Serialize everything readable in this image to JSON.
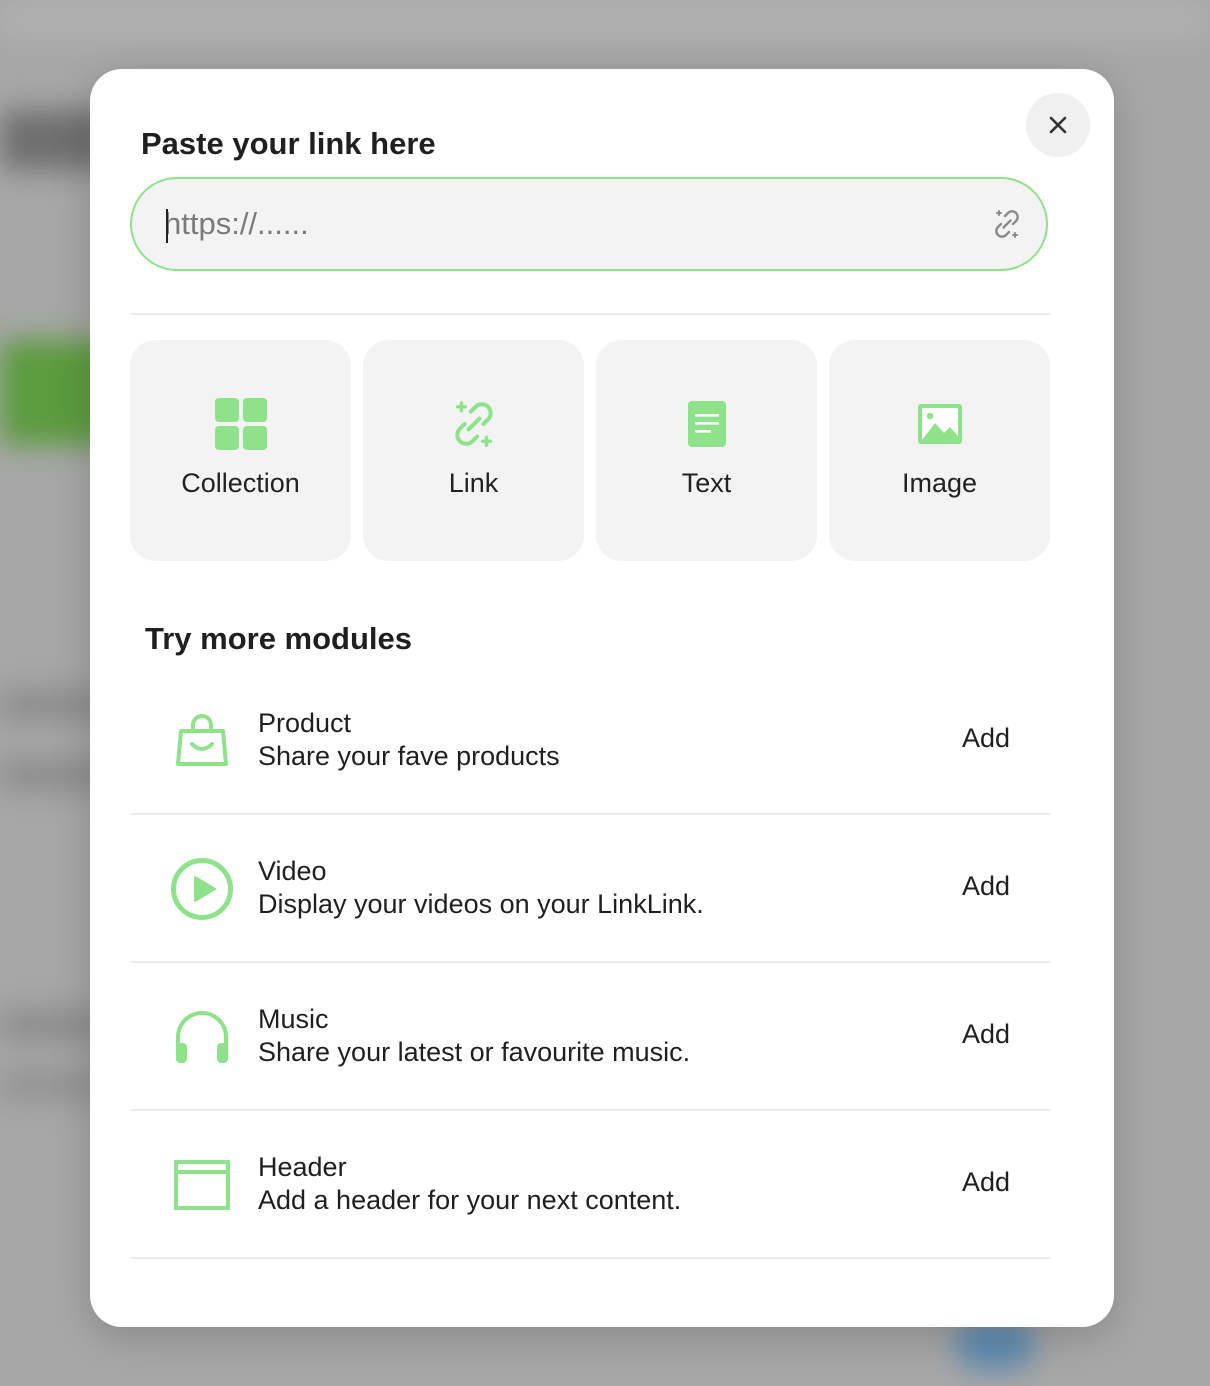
{
  "theme": {
    "accent": "#8ee28a",
    "tile_background": "#f3f3f3",
    "close_button_background": "#f0f0f0"
  },
  "modal": {
    "title": "Paste your link here",
    "close_icon": "close-icon",
    "url_input": {
      "value": "",
      "placeholder": "https://......",
      "icon": "link-icon"
    }
  },
  "tiles": [
    {
      "label": "Collection",
      "icon": "grid-icon"
    },
    {
      "label": "Link",
      "icon": "link-icon"
    },
    {
      "label": "Text",
      "icon": "document-icon"
    },
    {
      "label": "Image",
      "icon": "image-icon"
    }
  ],
  "more_modules": {
    "title": "Try more modules",
    "items": [
      {
        "name": "Product",
        "description": "Share your fave products",
        "action": "Add",
        "icon": "shopping-bag-icon"
      },
      {
        "name": "Video",
        "description": "Display your videos on your LinkLink.",
        "action": "Add",
        "icon": "play-circle-icon"
      },
      {
        "name": "Music",
        "description": "Share your latest or favourite music.",
        "action": "Add",
        "icon": "headphones-icon"
      },
      {
        "name": "Header",
        "description": "Add a header for your next content.",
        "action": "Add",
        "icon": "header-icon"
      }
    ]
  }
}
